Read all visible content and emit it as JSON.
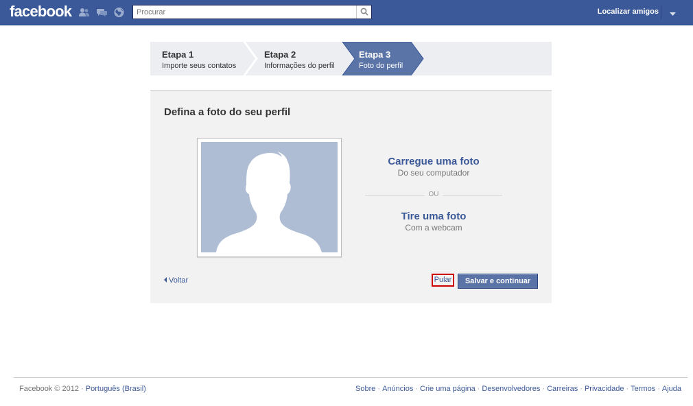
{
  "header": {
    "logo": "facebook",
    "search_placeholder": "Procurar",
    "find_friends": "Localizar amigos"
  },
  "steps": [
    {
      "title": "Etapa 1",
      "subtitle": "Importe seus contatos",
      "active": false
    },
    {
      "title": "Etapa 2",
      "subtitle": "Informações do perfil",
      "active": false
    },
    {
      "title": "Etapa 3",
      "subtitle": "Foto do perfil",
      "active": true
    }
  ],
  "main": {
    "title": "Defina a foto do seu perfil",
    "upload_title": "Carregue uma foto",
    "upload_sub": "Do seu computador",
    "or_text": "OU",
    "webcam_title": "Tire uma foto",
    "webcam_sub": "Com a webcam",
    "back_label": "Voltar",
    "skip_label": "Pular",
    "save_label": "Salvar e continuar"
  },
  "footer": {
    "copyright": "Facebook © 2012 ·",
    "language": "Português (Brasil)",
    "links": [
      "Sobre",
      "Anúncios",
      "Crie uma página",
      "Desenvolvedores",
      "Carreiras",
      "Privacidade",
      "Termos",
      "Ajuda"
    ]
  },
  "colors": {
    "brand_blue": "#3b5998",
    "active_step": "#5b74a8",
    "skip_highlight": "#cc0000",
    "silhouette_bg": "#afbdd4"
  }
}
